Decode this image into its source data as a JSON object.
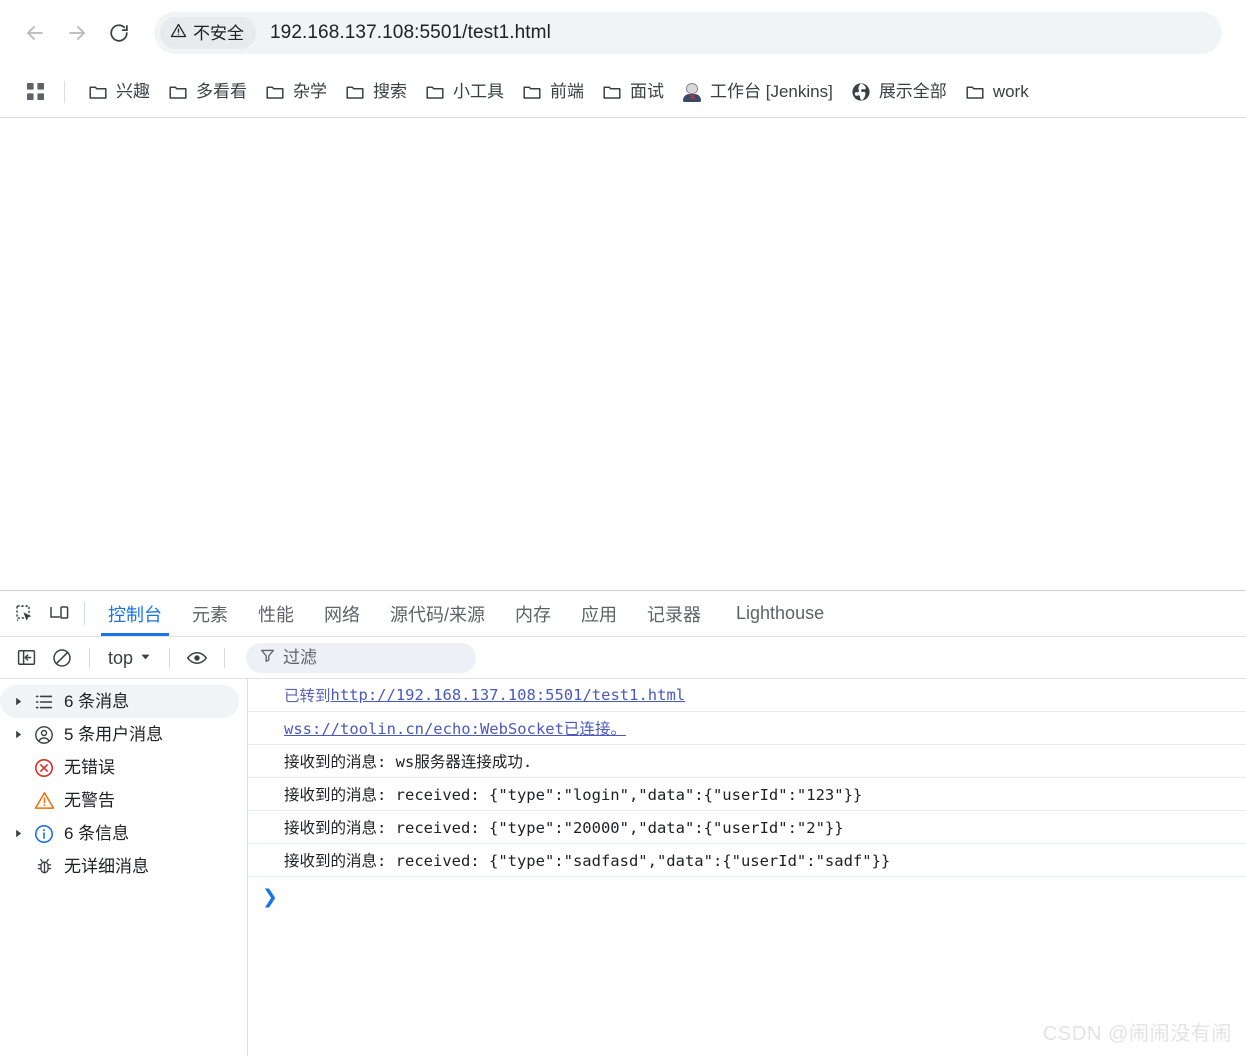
{
  "browser": {
    "nav": {
      "back_icon": "arrow-left-icon",
      "forward_icon": "arrow-right-icon",
      "reload_icon": "reload-icon"
    },
    "omnibox": {
      "security_icon": "warning-triangle-icon",
      "security_label": "不安全",
      "url": "192.168.137.108:5501/test1.html"
    },
    "bookmarks": {
      "apps_icon": "apps-grid-icon",
      "items": [
        {
          "label": "兴趣",
          "icon": "folder-icon"
        },
        {
          "label": "多看看",
          "icon": "folder-icon"
        },
        {
          "label": "杂学",
          "icon": "folder-icon"
        },
        {
          "label": "搜索",
          "icon": "folder-icon"
        },
        {
          "label": "小工具",
          "icon": "folder-icon"
        },
        {
          "label": "前端",
          "icon": "folder-icon"
        },
        {
          "label": "面试",
          "icon": "folder-icon"
        },
        {
          "label": "工作台 [Jenkins]",
          "icon": "jenkins-butler-icon"
        },
        {
          "label": "展示全部",
          "icon": "globe-icon"
        },
        {
          "label": "work",
          "icon": "folder-icon"
        }
      ]
    }
  },
  "devtools": {
    "inspect_icon": "inspect-element-icon",
    "device_icon": "device-toolbar-icon",
    "tabs": [
      {
        "label": "控制台",
        "active": true
      },
      {
        "label": "元素",
        "active": false
      },
      {
        "label": "性能",
        "active": false
      },
      {
        "label": "网络",
        "active": false
      },
      {
        "label": "源代码/来源",
        "active": false
      },
      {
        "label": "内存",
        "active": false
      },
      {
        "label": "应用",
        "active": false
      },
      {
        "label": "记录器",
        "active": false
      },
      {
        "label": "Lighthouse",
        "active": false
      }
    ],
    "toolbar": {
      "sidebar_toggle_icon": "show-console-sidebar-icon",
      "clear_icon": "clear-console-icon",
      "context_label": "top",
      "context_caret_icon": "chevron-down-icon",
      "eye_icon": "live-expression-eye-icon",
      "filter_icon": "filter-funnel-icon",
      "filter_placeholder": "过滤",
      "filter_value": ""
    },
    "sidebar": [
      {
        "label": "6 条消息",
        "icon": "messages-list-icon",
        "expandable": true,
        "selected": true
      },
      {
        "label": "5 条用户消息",
        "icon": "user-message-icon",
        "expandable": true,
        "selected": false
      },
      {
        "label": "无错误",
        "icon": "error-circle-icon",
        "expandable": false,
        "selected": false
      },
      {
        "label": "无警告",
        "icon": "warning-triangle-icon",
        "expandable": false,
        "selected": false
      },
      {
        "label": "6 条信息",
        "icon": "info-circle-icon",
        "expandable": true,
        "selected": false
      },
      {
        "label": "无详细消息",
        "icon": "verbose-bug-icon",
        "expandable": false,
        "selected": false
      }
    ],
    "log": [
      {
        "prefix": "已转到 ",
        "link": "http://192.168.137.108:5501/test1.html",
        "suffix": "",
        "style": "navigated"
      },
      {
        "prefix": "",
        "link": "wss://toolin.cn/echo:WebSocket已连接。",
        "suffix": "",
        "style": "link"
      },
      {
        "prefix": "接收到的消息: ws服务器连接成功.",
        "link": "",
        "suffix": "",
        "style": "plain"
      },
      {
        "prefix": "接收到的消息: received: {\"type\":\"login\",\"data\":{\"userId\":\"123\"}}",
        "link": "",
        "suffix": "",
        "style": "plain"
      },
      {
        "prefix": "接收到的消息: received: {\"type\":\"20000\",\"data\":{\"userId\":\"2\"}}",
        "link": "",
        "suffix": "",
        "style": "plain"
      },
      {
        "prefix": "接收到的消息: received: {\"type\":\"sadfasd\",\"data\":{\"userId\":\"sadf\"}}",
        "link": "",
        "suffix": "",
        "style": "plain"
      }
    ],
    "prompt_chevron": "❯"
  },
  "watermark": "CSDN @闹闹没有闹",
  "colors": {
    "accent": "#1a73e8",
    "link": "#4a59bd",
    "error": "#d93025",
    "warning": "#e8710a",
    "info": "#1a73e8",
    "chrome_bg": "#ffffff",
    "omnibox_bg": "#f1f3f4"
  }
}
